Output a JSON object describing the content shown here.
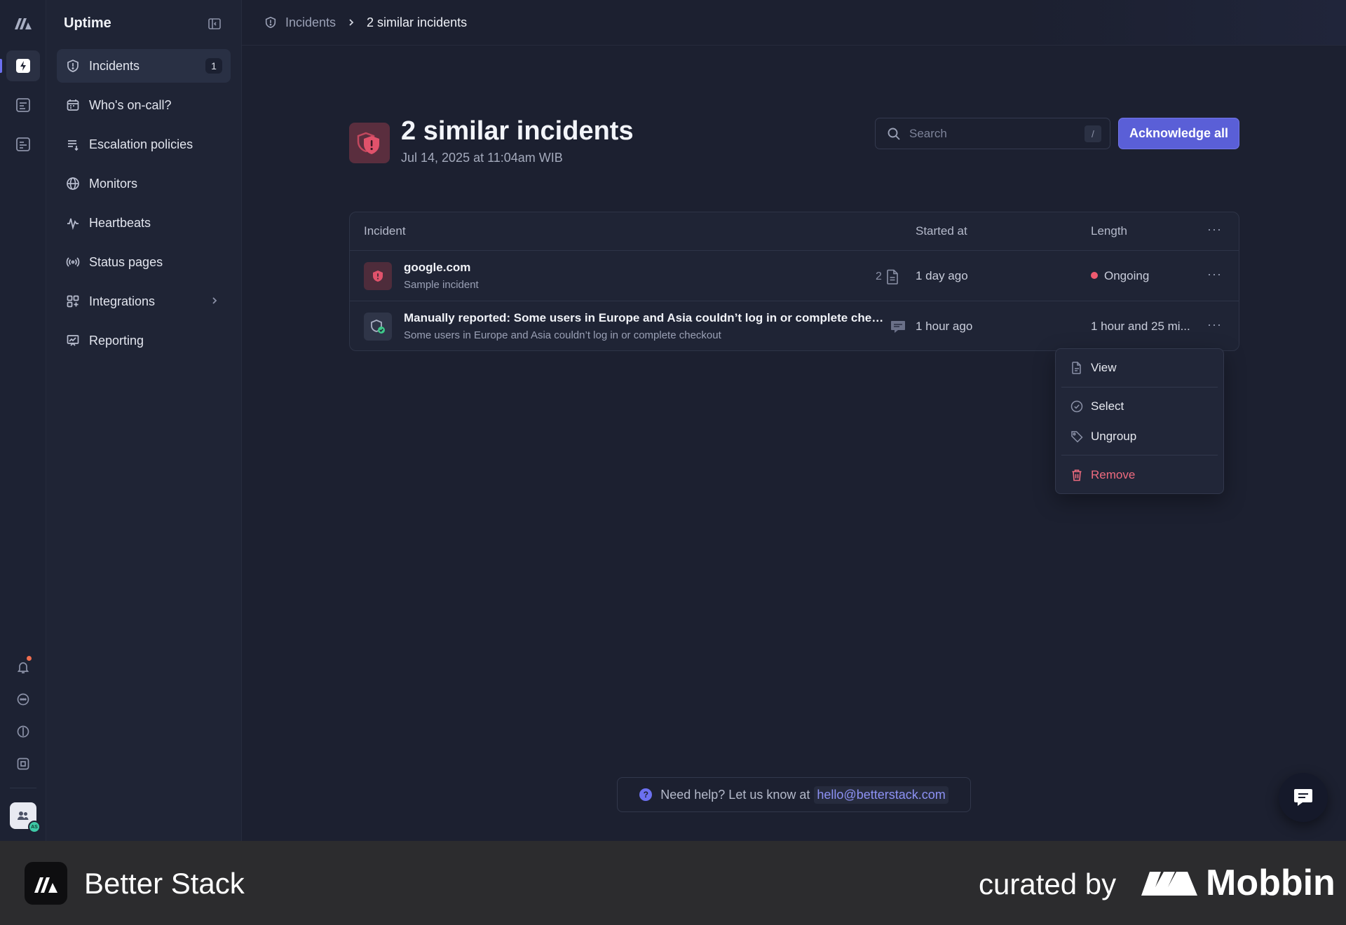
{
  "app": {
    "title": "Uptime"
  },
  "sidebar": {
    "items": [
      {
        "label": "Incidents",
        "count": "1",
        "icon": "shield-alert-icon"
      },
      {
        "label": "Who's on-call?",
        "icon": "calendar-icon"
      },
      {
        "label": "Escalation policies",
        "icon": "list-arrow-icon"
      },
      {
        "label": "Monitors",
        "icon": "globe-icon"
      },
      {
        "label": "Heartbeats",
        "icon": "pulse-icon"
      },
      {
        "label": "Status pages",
        "icon": "broadcast-icon"
      },
      {
        "label": "Integrations",
        "icon": "grid-plus-icon"
      },
      {
        "label": "Reporting",
        "icon": "chart-board-icon"
      }
    ]
  },
  "breadcrumb": {
    "parent": "Incidents",
    "current": "2 similar incidents"
  },
  "header": {
    "title": "2 similar incidents",
    "subtitle": "Jul 14, 2025 at 11:04am WIB"
  },
  "search": {
    "placeholder": "Search",
    "shortcut": "/"
  },
  "actions": {
    "acknowledge_all": "Acknowledge all"
  },
  "table": {
    "columns": {
      "incident": "Incident",
      "started_at": "Started at",
      "length": "Length"
    },
    "rows": [
      {
        "title": "google.com",
        "subtitle": "Sample incident",
        "related_count": "2",
        "started_at": "1 day ago",
        "length": "Ongoing"
      },
      {
        "title": "Manually reported: Some users in Europe and Asia couldn’t log in or complete che…",
        "subtitle": "Some users in Europe and Asia couldn’t log in or complete checkout",
        "started_at": "1 hour ago",
        "length": "1 hour and 25 mi..."
      }
    ]
  },
  "menu": {
    "view": "View",
    "select": "Select",
    "ungroup": "Ungroup",
    "remove": "Remove"
  },
  "help": {
    "text": "Need help? Let us know at",
    "email": "hello@betterstack.com"
  },
  "footer": {
    "brand": "Better Stack",
    "curated": "curated by",
    "curator": "Mobbin"
  },
  "colors": {
    "accent": "#5a5fd7",
    "danger": "#ee6b7f",
    "success": "#3ec9a7"
  }
}
